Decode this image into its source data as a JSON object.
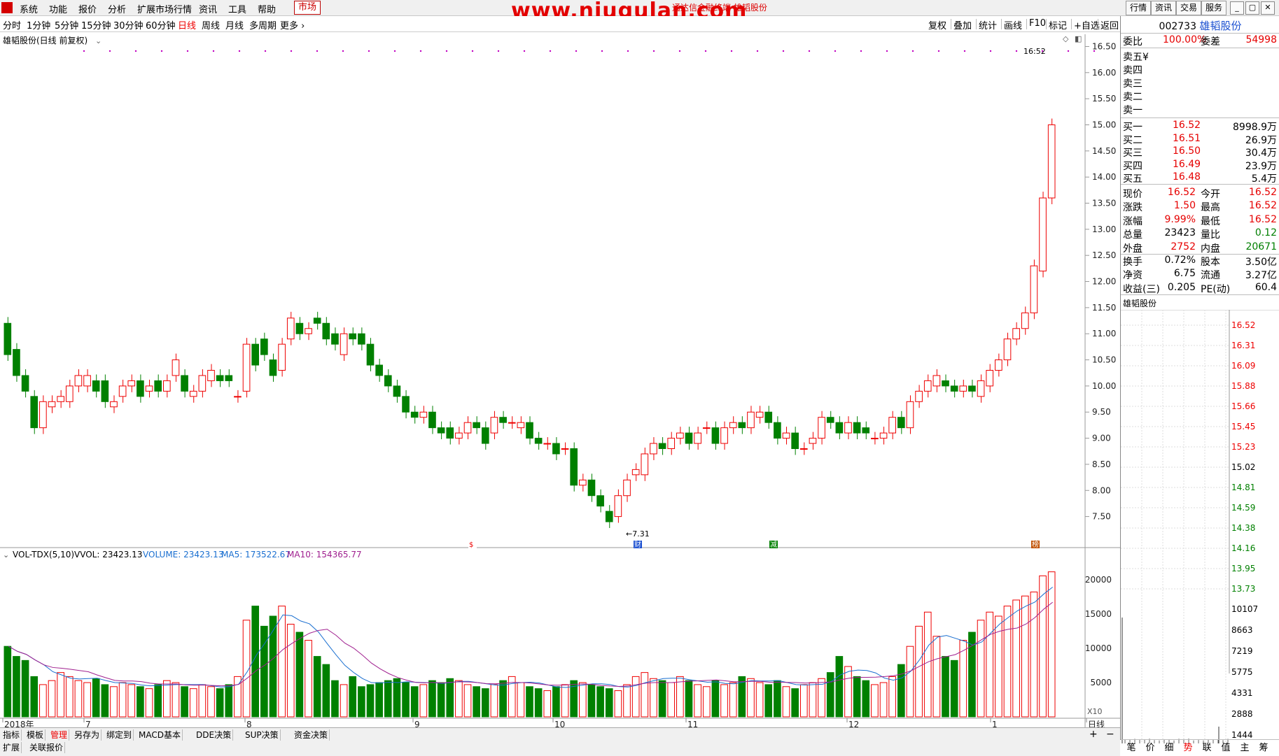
{
  "menu": {
    "items": [
      "系统",
      "功能",
      "报价",
      "分析",
      "扩展市场行情",
      "资讯",
      "工具",
      "帮助"
    ],
    "market": "市场",
    "watermark": "www.niugulan.com",
    "subtitle": "通达信金融终端  雄韬股份",
    "right_buttons": [
      "行情",
      "资讯",
      "交易",
      "服务"
    ]
  },
  "periods": {
    "items": [
      "分时",
      "1分钟",
      "5分钟",
      "15分钟",
      "30分钟",
      "60分钟",
      "日线",
      "周线",
      "月线",
      "多周期",
      "更多"
    ],
    "active": "日线"
  },
  "toolbar_right": [
    "复权",
    "叠加",
    "统计",
    "画线",
    "F10",
    "标记",
    "+自选",
    "返回"
  ],
  "chart": {
    "title": "雄韬股份(日线 前复权)",
    "latest_time": "16:52",
    "low_label": "7.31",
    "y_labels": [
      "16.50",
      "16.00",
      "15.50",
      "15.00",
      "14.50",
      "14.00",
      "13.50",
      "13.00",
      "12.50",
      "12.00",
      "11.50",
      "11.00",
      "10.50",
      "10.00",
      "9.50",
      "9.00",
      "8.50",
      "8.00",
      "7.50"
    ],
    "vol_y_labels": [
      "20000",
      "15000",
      "10000",
      "5000"
    ],
    "vol_unit": "X10",
    "x_labels": [
      "2018年",
      "7",
      "8",
      "9",
      "10",
      "11",
      "12",
      "1",
      "日线"
    ],
    "markers": [
      "$",
      "财",
      "减",
      "榜"
    ],
    "indicator": {
      "name": "VOL-TDX(5,10)",
      "vvol": "VVOL: 23423.13",
      "volume": "VOLUME: 23423.13",
      "ma5": "MA5: 173522.67",
      "ma10": "MA10: 154365.77"
    }
  },
  "chart_data": {
    "type": "candlestick",
    "title": "雄韬股份(日线 前复权)",
    "ylim": [
      7.2,
      16.6
    ],
    "y_ticks": [
      7.5,
      8,
      8.5,
      9,
      9.5,
      10,
      10.5,
      11,
      11.5,
      12,
      12.5,
      13,
      13.5,
      14,
      14.5,
      15,
      15.5,
      16,
      16.5
    ],
    "candles": [
      [
        11.2,
        10.6
      ],
      [
        10.7,
        10.2
      ],
      [
        10.2,
        9.9
      ],
      [
        9.8,
        9.2
      ],
      [
        9.2,
        9.7
      ],
      [
        9.6,
        9.7
      ],
      [
        9.7,
        9.8
      ],
      [
        9.7,
        10.0
      ],
      [
        10.0,
        10.2
      ],
      [
        10.0,
        10.2
      ],
      [
        10.1,
        9.9
      ],
      [
        10.1,
        9.7
      ],
      [
        9.6,
        9.7
      ],
      [
        9.8,
        10.0
      ],
      [
        10.0,
        10.1
      ],
      [
        10.1,
        9.8
      ],
      [
        9.9,
        10.0
      ],
      [
        10.1,
        9.9
      ],
      [
        9.9,
        10.1
      ],
      [
        10.2,
        10.5
      ],
      [
        10.2,
        9.9
      ],
      [
        9.8,
        9.9
      ],
      [
        9.9,
        10.2
      ],
      [
        10.1,
        10.3
      ],
      [
        10.2,
        10.1
      ],
      [
        10.2,
        10.1
      ],
      [
        9.8,
        9.8
      ],
      [
        9.9,
        10.8
      ],
      [
        10.8,
        10.4
      ],
      [
        10.9,
        10.6
      ],
      [
        10.5,
        10.2
      ],
      [
        10.3,
        10.8
      ],
      [
        10.9,
        11.3
      ],
      [
        11.2,
        11.0
      ],
      [
        11.0,
        11.1
      ],
      [
        11.3,
        11.2
      ],
      [
        11.2,
        10.9
      ],
      [
        11.0,
        10.8
      ],
      [
        10.6,
        11.0
      ],
      [
        11.0,
        10.9
      ],
      [
        11.0,
        10.8
      ],
      [
        10.8,
        10.4
      ],
      [
        10.4,
        10.2
      ],
      [
        10.2,
        10.0
      ],
      [
        10.0,
        9.8
      ],
      [
        9.8,
        9.5
      ],
      [
        9.5,
        9.4
      ],
      [
        9.4,
        9.5
      ],
      [
        9.5,
        9.2
      ],
      [
        9.2,
        9.1
      ],
      [
        9.2,
        9.0
      ],
      [
        9.0,
        9.1
      ],
      [
        9.1,
        9.3
      ],
      [
        9.3,
        9.2
      ],
      [
        9.2,
        8.9
      ],
      [
        9.1,
        9.4
      ],
      [
        9.4,
        9.3
      ],
      [
        9.3,
        9.3
      ],
      [
        9.2,
        9.3
      ],
      [
        9.3,
        9.0
      ],
      [
        9.0,
        8.9
      ],
      [
        8.9,
        8.9
      ],
      [
        8.9,
        8.7
      ],
      [
        8.8,
        8.8
      ],
      [
        8.8,
        8.1
      ],
      [
        8.1,
        8.2
      ],
      [
        8.2,
        7.9
      ],
      [
        7.9,
        7.7
      ],
      [
        7.6,
        7.4
      ],
      [
        7.5,
        7.9
      ],
      [
        7.9,
        8.2
      ],
      [
        8.3,
        8.4
      ],
      [
        8.3,
        8.7
      ],
      [
        8.7,
        8.9
      ],
      [
        8.9,
        8.8
      ],
      [
        8.8,
        9.0
      ],
      [
        9.0,
        9.1
      ],
      [
        9.1,
        8.9
      ],
      [
        8.9,
        9.1
      ],
      [
        9.2,
        9.2
      ],
      [
        9.2,
        8.9
      ],
      [
        8.9,
        9.2
      ],
      [
        9.2,
        9.3
      ],
      [
        9.3,
        9.2
      ],
      [
        9.2,
        9.5
      ],
      [
        9.4,
        9.5
      ],
      [
        9.5,
        9.3
      ],
      [
        9.3,
        9.0
      ],
      [
        9.0,
        9.1
      ],
      [
        9.1,
        8.8
      ],
      [
        8.8,
        8.8
      ],
      [
        8.9,
        9.0
      ],
      [
        9.0,
        9.4
      ],
      [
        9.4,
        9.3
      ],
      [
        9.3,
        9.1
      ],
      [
        9.1,
        9.3
      ],
      [
        9.3,
        9.1
      ],
      [
        9.2,
        9.1
      ],
      [
        9.0,
        9.0
      ],
      [
        9.0,
        9.1
      ],
      [
        9.1,
        9.4
      ],
      [
        9.4,
        9.2
      ],
      [
        9.2,
        9.7
      ],
      [
        9.7,
        9.9
      ],
      [
        9.9,
        10.1
      ],
      [
        10.0,
        10.2
      ],
      [
        10.1,
        10.0
      ],
      [
        10.0,
        9.9
      ],
      [
        9.9,
        10.0
      ],
      [
        10.0,
        9.9
      ],
      [
        9.8,
        10.1
      ],
      [
        10.0,
        10.3
      ],
      [
        10.3,
        10.5
      ],
      [
        10.5,
        10.9
      ],
      [
        10.9,
        11.1
      ],
      [
        11.1,
        11.4
      ],
      [
        11.4,
        12.3
      ],
      [
        12.2,
        13.6
      ],
      [
        13.6,
        15.0
      ]
    ],
    "volumes": [
      35,
      30,
      28,
      20,
      16,
      18,
      22,
      20,
      18,
      17,
      19,
      16,
      15,
      17,
      16,
      15,
      14,
      16,
      18,
      17,
      15,
      14,
      16,
      15,
      14,
      16,
      20,
      48,
      55,
      45,
      50,
      55,
      46,
      42,
      38,
      30,
      26,
      18,
      16,
      20,
      15,
      16,
      17,
      18,
      19,
      17,
      15,
      16,
      18,
      17,
      19,
      18,
      16,
      15,
      14,
      16,
      18,
      20,
      17,
      15,
      14,
      13,
      15,
      16,
      18,
      17,
      16,
      15,
      14,
      13,
      16,
      20,
      22,
      19,
      18,
      17,
      20,
      18,
      16,
      15,
      18,
      16,
      17,
      20,
      19,
      17,
      16,
      18,
      15,
      14,
      16,
      17,
      19,
      22,
      30,
      25,
      20,
      18,
      16,
      17,
      20,
      26,
      35,
      45,
      52,
      40,
      30,
      28,
      38,
      42,
      48,
      52,
      50,
      55,
      58,
      60,
      62,
      70,
      72
    ],
    "ma5_label": "MA5",
    "ma10_label": "MA10"
  },
  "quote": {
    "code": "002733",
    "name": "雄韬股份",
    "weibi_label": "委比",
    "weibi": "100.00%",
    "weicha_label": "委差",
    "weicha": "54998",
    "sells": [
      {
        "label": "卖五",
        "price": "",
        "vol": ""
      },
      {
        "label": "卖四",
        "price": "",
        "vol": ""
      },
      {
        "label": "卖三",
        "price": "",
        "vol": ""
      },
      {
        "label": "卖二",
        "price": "",
        "vol": ""
      },
      {
        "label": "卖一",
        "price": "",
        "vol": ""
      }
    ],
    "sell5_mark": "¥",
    "buys": [
      {
        "label": "买一",
        "price": "16.52",
        "vol": "8998.9万"
      },
      {
        "label": "买二",
        "price": "16.51",
        "vol": "26.9万"
      },
      {
        "label": "买三",
        "price": "16.50",
        "vol": "30.4万"
      },
      {
        "label": "买四",
        "price": "16.49",
        "vol": "23.9万"
      },
      {
        "label": "买五",
        "price": "16.48",
        "vol": "5.4万"
      }
    ],
    "stats": [
      [
        "现价",
        "16.52",
        "今开",
        "16.52"
      ],
      [
        "涨跌",
        "1.50",
        "最高",
        "16.52"
      ],
      [
        "涨幅",
        "9.99%",
        "最低",
        "16.52"
      ],
      [
        "总量",
        "23423",
        "量比",
        "0.12"
      ],
      [
        "外盘",
        "2752",
        "内盘",
        "20671"
      ],
      [
        "换手",
        "0.72%",
        "股本",
        "3.50亿"
      ],
      [
        "净资",
        "6.75",
        "流通",
        "3.27亿"
      ],
      [
        "收益(三)",
        "0.205",
        "PE(动)",
        "60.4"
      ]
    ],
    "mini_title": "雄韬股份",
    "mini_prices": [
      "16.52",
      "16.31",
      "16.09",
      "15.88",
      "15.66",
      "15.45",
      "15.23",
      "15.02",
      "14.81",
      "14.59",
      "14.38",
      "14.16",
      "13.95",
      "13.73"
    ],
    "mini_vols": [
      "10107",
      "8663",
      "7219",
      "5775",
      "4331",
      "2888",
      "1444"
    ],
    "tabs": [
      "笔",
      "价",
      "细",
      "势",
      "联",
      "值",
      "主",
      "筹"
    ],
    "active_tab": "势"
  },
  "bottom": {
    "tabs1": [
      "指标",
      "模板",
      "管理",
      "另存为",
      "绑定到",
      "MACD基本",
      "DDE决策",
      "SUP决策",
      "资金决策"
    ],
    "active": "管理",
    "tabs2": [
      "扩展",
      "关联报价"
    ]
  }
}
